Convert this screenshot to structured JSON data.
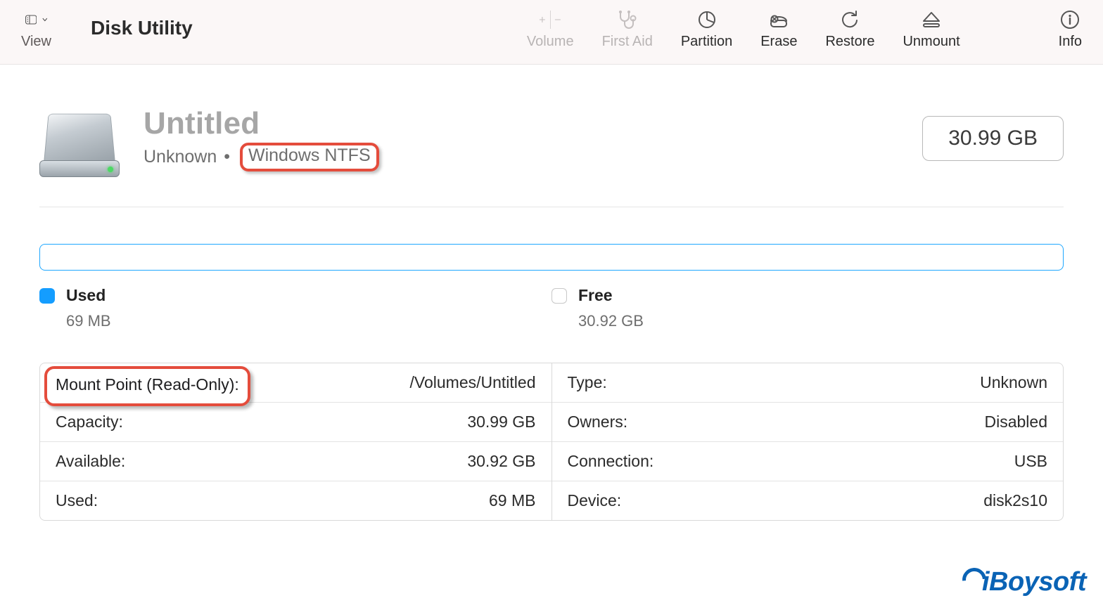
{
  "app": {
    "title": "Disk Utility"
  },
  "toolbar": {
    "view": "View",
    "volume": "Volume",
    "firstaid": "First Aid",
    "partition": "Partition",
    "erase": "Erase",
    "restore": "Restore",
    "unmount": "Unmount",
    "info": "Info"
  },
  "volume": {
    "name": "Untitled",
    "sub_left": "Unknown",
    "sub_dot": "•",
    "fs": "Windows NTFS",
    "size_chip": "30.99 GB"
  },
  "usage": {
    "used_label": "Used",
    "used_value": "69 MB",
    "free_label": "Free",
    "free_value": "30.92 GB"
  },
  "info": {
    "left": [
      {
        "key": "Mount Point (Read-Only):",
        "val": "/Volumes/Untitled"
      },
      {
        "key": "Capacity:",
        "val": "30.99 GB"
      },
      {
        "key": "Available:",
        "val": "30.92 GB"
      },
      {
        "key": "Used:",
        "val": "69 MB"
      }
    ],
    "right": [
      {
        "key": "Type:",
        "val": "Unknown"
      },
      {
        "key": "Owners:",
        "val": "Disabled"
      },
      {
        "key": "Connection:",
        "val": "USB"
      },
      {
        "key": "Device:",
        "val": "disk2s10"
      }
    ]
  },
  "watermark": "iBoysoft"
}
